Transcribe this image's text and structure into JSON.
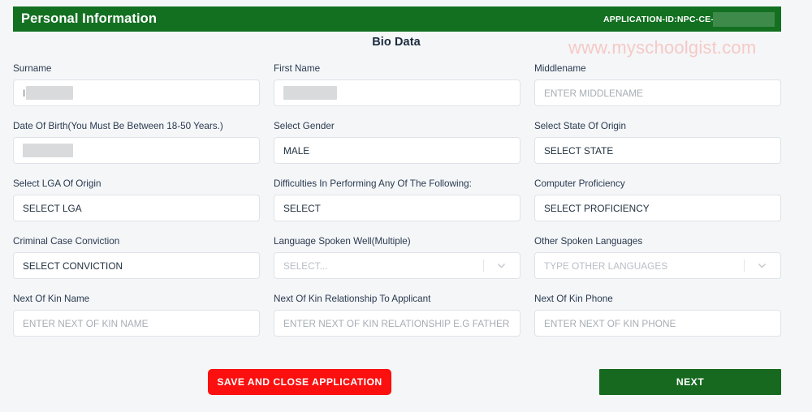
{
  "header": {
    "title": "Personal Information",
    "application_id_label": "APPLICATION-ID:NPC-CE-",
    "bar_color": "#137021"
  },
  "section": {
    "title": "Bio Data"
  },
  "watermark": {
    "text": "www.myschoolgist.com",
    "color": "#f6c9c6"
  },
  "fields": [
    {
      "label": "Surname",
      "type": "text",
      "value": "",
      "redacted": true,
      "redact_width": 58,
      "redact_prefix": "I",
      "placeholder": ""
    },
    {
      "label": "First Name",
      "type": "text",
      "value": "",
      "redacted": true,
      "redact_width": 66,
      "redact_prefix": "",
      "placeholder": ""
    },
    {
      "label": "Middlename",
      "type": "text",
      "value": "",
      "redacted": false,
      "placeholder": "ENTER MIDDLENAME"
    },
    {
      "label": "Date Of Birth(You Must Be Between 18-50 Years.)",
      "type": "date",
      "value": "",
      "redacted": true,
      "redact_width": 62,
      "redact_prefix": "",
      "placeholder": ""
    },
    {
      "label": "Select Gender",
      "type": "select",
      "value": "MALE",
      "redacted": false,
      "placeholder": ""
    },
    {
      "label": "Select State Of Origin",
      "type": "select",
      "value": "SELECT STATE",
      "redacted": false,
      "placeholder": ""
    },
    {
      "label": "Select LGA Of Origin",
      "type": "select",
      "value": "SELECT LGA",
      "redacted": false,
      "placeholder": ""
    },
    {
      "label": "Difficulties In Performing Any Of The Following:",
      "type": "select",
      "value": "SELECT",
      "redacted": false,
      "placeholder": ""
    },
    {
      "label": "Computer Proficiency",
      "type": "select",
      "value": "SELECT PROFICIENCY",
      "redacted": false,
      "placeholder": ""
    },
    {
      "label": "Criminal Case Conviction",
      "type": "select",
      "value": "SELECT CONVICTION",
      "redacted": false,
      "placeholder": ""
    },
    {
      "label": "Language Spoken Well(Multiple)",
      "type": "multiselect",
      "value": "",
      "redacted": false,
      "placeholder": "SELECT..."
    },
    {
      "label": "Other Spoken Languages",
      "type": "multiselect",
      "value": "",
      "redacted": false,
      "placeholder": "TYPE OTHER LANGUAGES"
    },
    {
      "label": "Next Of Kin Name",
      "type": "text",
      "value": "",
      "redacted": false,
      "placeholder": "ENTER NEXT OF KIN NAME"
    },
    {
      "label": "Next Of Kin Relationship To Applicant",
      "type": "text",
      "value": "",
      "redacted": false,
      "placeholder": "ENTER NEXT OF KIN RELATIONSHIP E.G FATHER"
    },
    {
      "label": "Next Of Kin Phone",
      "type": "text",
      "value": "",
      "redacted": false,
      "placeholder": "ENTER NEXT OF KIN PHONE"
    }
  ],
  "buttons": {
    "save_label": "SAVE AND CLOSE APPLICATION",
    "save_color": "#fb0f0f",
    "next_label": "NEXT",
    "next_color": "#17691f"
  }
}
